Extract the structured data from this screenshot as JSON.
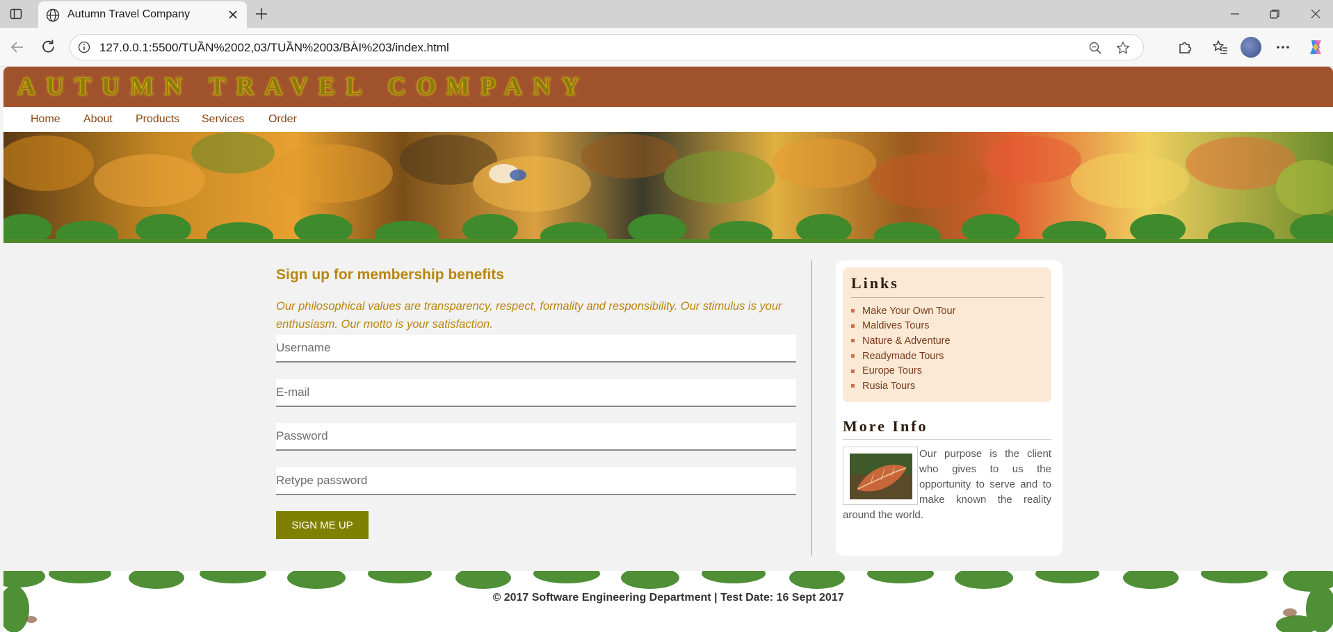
{
  "browser": {
    "tab_title": "Autumn Travel Company",
    "url": "127.0.0.1:5500/TUẦN%2002,03/TUẦN%2003/BÀI%203/index.html"
  },
  "site": {
    "title": "AUTUMN TRAVEL COMPANY",
    "nav": [
      "Home",
      "About",
      "Products",
      "Services",
      "Order"
    ]
  },
  "form": {
    "heading": "Sign up for membership benefits",
    "intro": "Our philosophical values are transparency, respect, formality and responsibility. Our stimulus is your enthusiasm. Our motto is your satisfaction.",
    "username_placeholder": "Username",
    "email_placeholder": "E-mail",
    "password_placeholder": "Password",
    "retype_placeholder": "Retype password",
    "submit_label": "SIGN ME UP"
  },
  "sidebar": {
    "links_heading": "Links",
    "links": [
      "Make Your Own Tour",
      "Maldives Tours",
      "Nature & Adventure",
      "Readymade Tours",
      "Europe Tours",
      "Rusia Tours"
    ],
    "more_heading": "More Info",
    "more_text": "Our purpose is the client who gives to us the opportunity to serve and to make known the reality around the world."
  },
  "footer": {
    "text": "© 2017 Software Engineering Department | Test Date: 16 Sept 2017"
  },
  "colors": {
    "header_bg": "#a0522d",
    "accent_gold": "#b8860b",
    "button_olive": "#808000",
    "links_box_bg": "#fbe9d6"
  },
  "icons": [
    "sidebar-toggle-icon",
    "globe-icon",
    "close-icon",
    "plus-icon",
    "minimize-icon",
    "restore-icon",
    "window-close-icon",
    "back-icon",
    "reload-icon",
    "info-icon",
    "zoom-out-icon",
    "favorite-star-icon",
    "extensions-icon",
    "favorites-icon",
    "more-icon",
    "copilot-icon"
  ]
}
